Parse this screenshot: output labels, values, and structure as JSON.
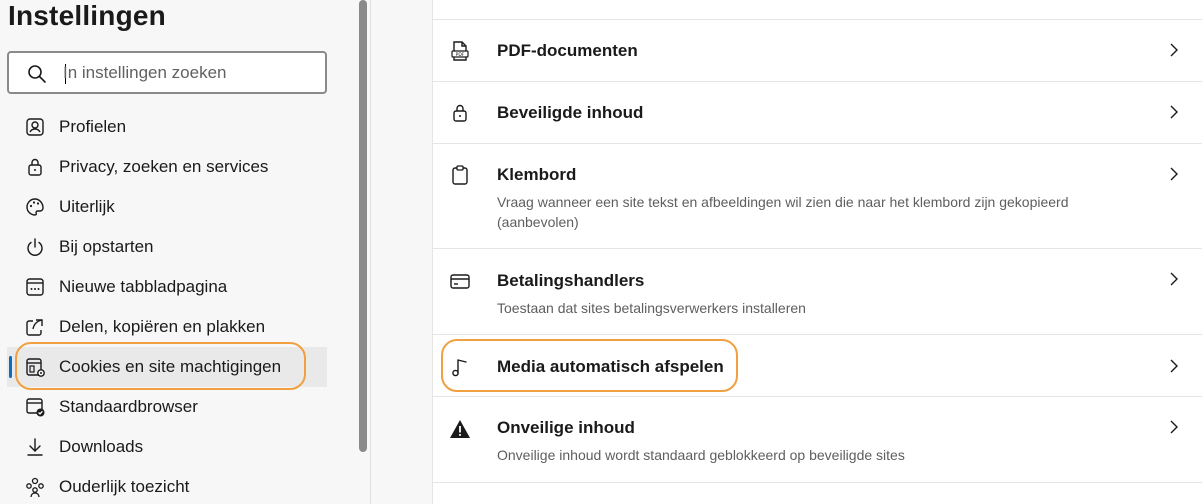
{
  "sidebar": {
    "title": "Instellingen",
    "search_placeholder": "In instellingen zoeken",
    "items": [
      {
        "label": "Profielen",
        "icon": "profile-icon"
      },
      {
        "label": "Privacy, zoeken en services",
        "icon": "lock-icon"
      },
      {
        "label": "Uiterlijk",
        "icon": "palette-icon"
      },
      {
        "label": "Bij opstarten",
        "icon": "power-icon"
      },
      {
        "label": "Nieuwe tabbladpagina",
        "icon": "new-tab-icon"
      },
      {
        "label": "Delen, kopiëren en plakken",
        "icon": "share-icon"
      },
      {
        "label": "Cookies en site machtigingen",
        "icon": "cookies-icon"
      },
      {
        "label": "Standaardbrowser",
        "icon": "default-browser-icon"
      },
      {
        "label": "Downloads",
        "icon": "download-icon"
      },
      {
        "label": "Ouderlijk toezicht",
        "icon": "family-icon"
      }
    ]
  },
  "main": {
    "rows": [
      {
        "title": "PDF-documenten",
        "desc": "",
        "icon": "pdf-icon"
      },
      {
        "title": "Beveiligde inhoud",
        "desc": "",
        "icon": "lock-icon"
      },
      {
        "title": "Klembord",
        "desc": "Vraag wanneer een site tekst en afbeeldingen wil zien die naar het klembord zijn gekopieerd (aanbevolen)",
        "icon": "clipboard-icon"
      },
      {
        "title": "Betalingshandlers",
        "desc": "Toestaan dat sites betalingsverwerkers installeren",
        "icon": "card-icon"
      },
      {
        "title": "Media automatisch afspelen",
        "desc": "",
        "icon": "music-note-icon"
      },
      {
        "title": "Onveilige inhoud",
        "desc": "Onveilige inhoud wordt standaard geblokkeerd op beveiligde sites",
        "icon": "warning-icon"
      }
    ]
  },
  "colors": {
    "accent": "#0f6cbd",
    "highlight": "#f0a040"
  }
}
